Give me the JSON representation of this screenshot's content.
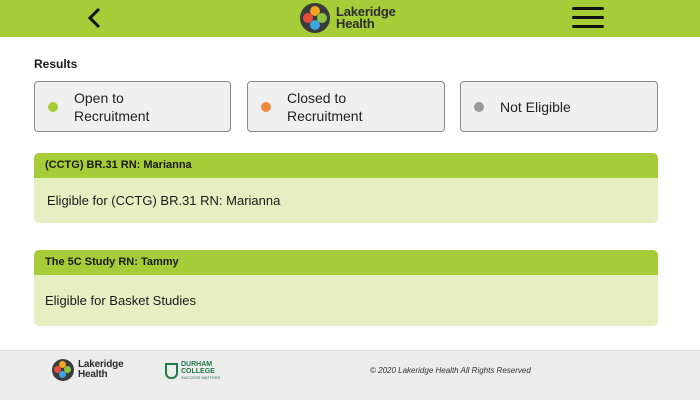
{
  "header": {
    "brand_line1": "Lakeridge",
    "brand_line2": "Health"
  },
  "results": {
    "label": "Results"
  },
  "legend": [
    {
      "label": "Open to\nRecruitment",
      "color": "#a6cd37"
    },
    {
      "label": "Closed to\nRecruitment",
      "color": "#f08a3e"
    },
    {
      "label": "Not Eligible",
      "color": "#9a9a9a"
    }
  ],
  "cards": [
    {
      "title": "(CCTG) BR.31 RN: Marianna",
      "body": "Eligible for (CCTG) BR.31 RN: Marianna"
    },
    {
      "title": "The 5C Study RN: Tammy",
      "body": "Eligible for Basket Studies"
    }
  ],
  "footer": {
    "brand_line1": "Lakeridge",
    "brand_line2": "Health",
    "partner_line1": "DURHAM",
    "partner_line2": "COLLEGE",
    "partner_tagline": "SUCCESS MATTERS",
    "copyright": "© 2020 Lakeridge Health All Rights Reserved"
  },
  "colors": {
    "accent": "#a6cd37",
    "card_bg": "#e6efc2",
    "footer_bg": "#ececec"
  }
}
